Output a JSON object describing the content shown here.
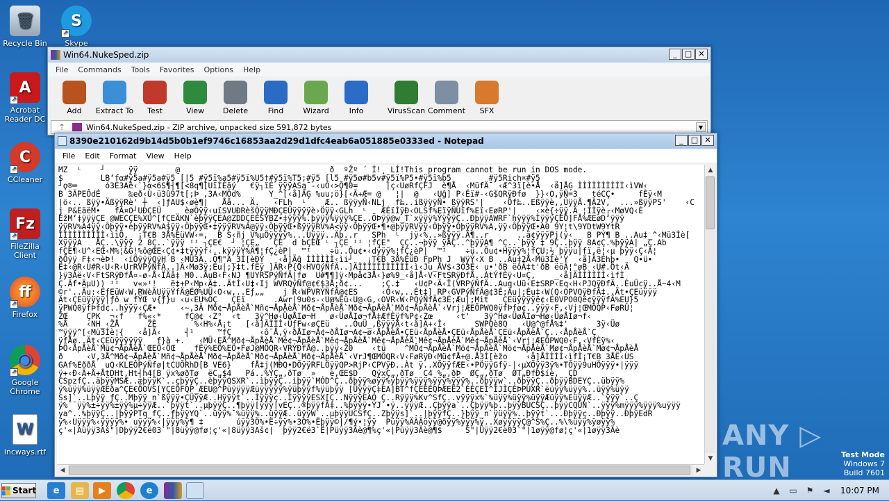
{
  "desktop": {
    "icons": [
      {
        "name": "recycle-bin",
        "label": "Recycle Bin",
        "glyph": "🗑"
      },
      {
        "name": "skype",
        "label": "Skype",
        "glyph": "S"
      },
      {
        "name": "acrobat-reader",
        "label": "Acrobat Reader DC",
        "glyph": "A"
      },
      {
        "name": "ccleaner",
        "label": "CCleaner",
        "glyph": "C"
      },
      {
        "name": "filezilla",
        "label": "FileZilla Client",
        "glyph": "Fz"
      },
      {
        "name": "firefox",
        "label": "Firefox",
        "glyph": "ff"
      },
      {
        "name": "chrome",
        "label": "Google Chrome",
        "glyph": "◉"
      },
      {
        "name": "incways-rtf",
        "label": "incways.rtf",
        "glyph": "W"
      }
    ]
  },
  "winrar": {
    "title": "Win64.NukeSped.zip",
    "menu": [
      "File",
      "Commands",
      "Tools",
      "Favorites",
      "Options",
      "Help"
    ],
    "toolbar": [
      {
        "label": "Add",
        "icon": "add-icon",
        "color": "#b8521e"
      },
      {
        "label": "Extract To",
        "icon": "folder-icon",
        "color": "#3b8fd6"
      },
      {
        "label": "Test",
        "icon": "test-icon",
        "color": "#c0392b"
      },
      {
        "label": "View",
        "icon": "book-icon",
        "color": "#2e8b3d"
      },
      {
        "label": "Delete",
        "icon": "trash-icon",
        "color": "#6f7a85"
      },
      {
        "label": "Find",
        "icon": "magnifier-icon",
        "color": "#2a6cc4"
      },
      {
        "label": "Wizard",
        "icon": "wand-icon",
        "color": "#6aa84f"
      },
      {
        "label": "Info",
        "icon": "info-icon",
        "color": "#2b6cc7"
      },
      {
        "label": "VirusScan",
        "icon": "bug-icon",
        "color": "#2e7d32"
      },
      {
        "label": "Comment",
        "icon": "comment-icon",
        "color": "#7d8fa3"
      },
      {
        "label": "SFX",
        "icon": "box-icon",
        "color": "#d8792b"
      }
    ],
    "path_text": "Win64.NukeSped.zip - ZIP archive, unpacked size 591,872 bytes"
  },
  "notepad": {
    "title": "8390e210162d9b14d5b0b1ef9746c16853aa2d29d1dfc4eab6a051885e0333ed - Notepad",
    "menu": [
      "File",
      "Edit",
      "Format",
      "View",
      "Help"
    ],
    "lines": [
      "MZ  ᴸ    ┘     ÿÿ        @                                ð  ºŽº ´ Í!¸ LÍ!This program cannot be run in DOS mode.",
      "$        LB‘fα#ÿ5a#ÿ5a#ÿ5 [|5 #ÿ5ï%a5#ÿ5ï%U5†#ÿ5ï%T5;#ÿ5 [l5 #ÿ5ø#b5v#ÿ5ï%P5•#ÿ5ï%b5        #ÿ5Rich¤#ÿ5",
      "┘ϙ®═      ó3È3Aê‹`}α<6S¶┤¶[<8q¶[UïÌÉäý   €ÿ┐ïÉ ÿÿÿASą¯-‹uÓ‹>Ǭ¶0=      |ç‹UøRfÇFJ  è¶Å  ‹MüfÄ¯_‹Æ^3ï[è•Å  ‹å]ÅĢ ÌÌÌÌÌÌÌÌÌÌ‹ìVW‹",
      "B 3ÃPEÔdÉ      ‰eð‹Ù‹ü3û97t[;Þ ,3A‹MÖd%      Y_^[‹å]ÃĢ %uu;ö}[‹Ã+Æ= @   ¦|  @   ‹Uĝ] P‹Éï#-‹G$QRÿÐfø  }}‹O,ÿÑ=3   téCÇ•     fÈÿ‹M",
      "|ö‹.. ßÿÿ•ÄßÿÿRè' ┼  ‹]ƒAU$‹øè¶|   Åå... Ä.   ‹FLh  ᴸ    Æ.. ßÿÿyÑ‹NLj  f‰..íßÿÿÿÑ• ßÿÿRS'|    ‹Öf‰..Eßÿÿè,,ÛÿÿÃ.¶Ä2V,  ...»ßÿÿPS'    ‹C",
      "j P&EäëM•   fÃ¤O┘UÐÇEÜ     èøÕÿÿ‹uïSVUÐRèšÕÿÿMÐÇEÜÿÿÿÿè›Öÿÿ‹GLh  ᴸ   ÆÉïÌÿÐ‹OLSf%EïÿÑUïf%Eï‹EøRP'|    ‹×è{÷ÿÿ.Ä ¦ÍÌÿè┌‹MøVQ‹È",
      "ÉžM‘‡ÿÿÿÇE @WECÇE%XU^[fÇEÄKN`èþÿÿÇEA@ZDDÇEÉSÝBZ•‡ÿÿÿ%.þÿÿÿ%ÿÿÿ%ÇE..ÕÞÿÿ@w_T`xÿÿÿ%ÝÿÿÿÇ..ÐþÿÿAWRF`hÿÿÿ%ÌÿÿÿÇEÖ]FÅ%ÆEøD‘ÿÿÿ",
      "ÿÿRV%A4ÿÿ‹Ôþÿÿ•èþÿÿRV%A$ÿÿ‹ÔþÿÿŒ•‡ÿÿÿRV%A@ÿÿ‹ÔþÿÿŒ•ßÿÿÿRV%A<ÿÿ‹ÔþÿÿŒ•¶•@þÿÿRVÿÿ‹Ôþÿÿ•ÒþÿÿRV%A,ÿÿ‹ÔþÿÿŒ•A0_9Y¦t\\9YDtW9YtR",
      "ÌÌÌÌÌÌÌÌÌÌ‹ìiÖ,  ¡T€B 3Å%EüVW‹=,  B S‹ñj V%µÖÿÿÿÿ%...Uÿÿÿ..Äþ..r   SPh  ᴸ  jÿ‹%..»ßÿÿÿ.Ä¶..r      ..ä¢ÿÿÿPj(ÿ‹   B PÝ¶ B ..Au‡_^‹Mü3Íè[",
      "XÿÿÿA   ÅÇ..\\ÿÿÿ 2 8Ç..`ÿÿÿ ᴵᴵ ┐ÇE€  ┘ ¦ÇE„   ÇE  d bÇEŒ ᴸ ┐ÇE ᴵᴵ ¦fÇE\"  ÇÇ..¬þÿÿ ÿÃÇ..^þÿÿA¶ ^Ç..`þÿÿ ‡ 9Ç..þÿÿ 8A¢Ç.%þÿÿA| „Ç.Ab",
      "fÇE¶‹U^‹EŒ‹M%¦&G!%ô@ŒE‹Ç¢•‡tÿÿÿf‹..kÿÿÿY%Ä¶¦fÇ¿èP|  ™ᴵ    ÷ü..Ôu¢•‹dÿÿÿ%¦fÇ¿èP|  ™ᴵ    ÷ü..Ôu¢•Hÿÿÿ%¦fÇU;½ þÿÿu|fï,ë¦‹µ þÿÿ‹Ç‹Ä¦",
      "ðÕÿÿ F‡‹¬èÞ!  ‹íÖÿÿÿQÿH B ‹MÜ3A..Õ¶\"A_3Í[èÐÝ   ‹å]Äĝ ÌÌÌÌÌÌ‹ìi┘   ¡T€B 3Å%EüÐ FpPh J  WÿÝ‹X B ..Au‡2Å‹Mü3Íè'Y  ‹å]Ä3Éhþ•   Q•ü•",
      "Ë‡‹@R‹U#R‹U‹R‹UrRVPýÑfÄ..]Ä‹Mø3ÿ;Éu|;}‡t.fÈÿ_]ÄR‹P{Q‹HVQýÑfÄ..]ÄÌÌÌÌÌÌÌÌÌÌÌ‹ì‹Ju_ÅV$‹3Ó3É‹ u•'ðB ëôÃ‡t'ðB ëöÃ¦°øB ‹U#.Öt‹Ä",
      "}ÿ3Áë‹V‹FtSRÿÐfÅ¤-ø-Å‹ÏÄå‡ M0..ÄuB‹F‹NJ ¶UYRSPýÑfÄ|fø  U#¶¶]ÿ‹Mpå¢3Å‹}ø%9_‹å]Å‹V‹FtSRÿÐfÅ..ÀtÝfÈÿ‹U¤Ç,    _‹å]ÄÌÌÌÌÌÌ‹ìfÌ",
      "Ç.Äf•ÄµU)) ᴵᴵ   v«»ᴵ!   ë‡+P‹Mp‹Ä‡..ÄtÌ‹U‡‹Ij WVRQýÑf@¢€$3Å;ð¢...    ;Ç.‡   ‹U¢P‹Ä‹Ï(VRPýÑfÄ..Auq‹Uü‹E‡SRP‹Eq‹H‹PJQÿÐfÄ..ÉuÜcÿ..Å~4‹M",
      "©r'..Äu:‹ÉƒEüW‹W,RWèÄUÿÿÝfÄ@ÉØ%UÜ‹O‹w,..Eƒ„„    j R‹WPVRÝÑfÄ@¢ES     ‹O‹w,..Ét‡] RP‹GVPýÑfÄ@¢3É;Äu|;Éu‡‹W(Q‹OPVQÿÐfÄ‡..Ät•ÇEüÿÿÿ",
      "Ät‹ÇEüÿÿÿÿ|ƒô w_fŸŒ v{ƒ}u ‹u‹EU%ÕÇ   ÇEï      .Awr|9u0s-‹U@%Eü‹U@‹G,‹OVR‹W‹PQýÑfÄ¢3É;Æu|;Mit   ÇEüÿÿÿÿë¢‹E0VPO0Që¢ÿÿÿfÄ%EU}5",
      "ÿPWQ0ÿfÞfd¢..hÿÿÿ‹ÇÆ•     ‹~,3Â Mð¢¬ÅpÅèÅ`Mñ¢¬ÅpÅèÅ`Mð¢¬ÅpÅèÅ`Mð¢¬ÅpÅèÅ`Mð¢¬ÅpÅèÅ`‹Vrj¦ÆEÕPWQ0ÿfÞfø¢..ÿÿÿ‹F‚‹Vj¦ŒMÖQP‹FøRÛ¦",
      "ŽŒ    ÇPK  ¬‹f   f%«‹*     fÇ@¢ ‹Z°  ‹t   3ÿ^Hø‹ÜøÅIø¬H   ø‹ÜøÅIø¬fÅ‡ÆfÈÿf%P¢‹Zœ     ‹t'   3ÿ^Hø‹ÜøÅIø¬Hø‹ÜøÅIø¬f‹",
      "%Å    ‹NH_‹ŽÅ      ŽÈ        %‹H%‹Å¡t   [‹å]ÃÌÌÌ‹ÜƒFw‹øÇEü   ..ÔuÜ_,ßÿÿÿÅ‹t‹å]Ä+‹Ì‹      SWPQè8Q   ‹U@^@fÅ%‡'      3ÿ‹Üø",
      "™ÿÿÿ^[‹Mü3Íè¦{   ‹å]Ä‹     ┤¹     ™fÇ      ‹ô¯Å,ÿ‹ðÅIø¬A¢~ðÅIø¬A¢~ø‹ÅpÅèÅ•ÇEü‹ÅpÅèÅ•ÇEü‹ÅpÅèÅ`ÇEü‹ÅpÅèÅ`Ç..‹ÅpÅèÅ`Ç",
      "ÿfÅø..Ät‹ÇEüÿÿÿÿÿÿ   f}à +.   ‹MÜ‹EÅ^Mð¢¬ÅpÅèÅ`Mé¢¬ÅpÅèÅ`Mê¢¬ÅpÅèÅ`Mê¢¬ÅpÅèÅ`Mê¢¬ÅpÅèÅ`Mê¢¬ÅpÅèÅ`‹Vrj¦ÆEÕPWQ0‹F‚‹VfÈÿ%‹",
      "ÞÖ‹ÅpÅèÅ`Mü¢¬ÅpÅèÅ`ŒEÖ‹ÖŒ    fÈÿ%EÖ%EÖ•FøJ@MÔQR‹VRÝÐfÅ@..þÿÿ‹Ž0    ‹tü    ^MÔ¢¬ÅpÅèÅ`Mö¢¬ÅpÅèÅ`Mö¢¬ÅpÅèÅ`Mø¢¬ÅpÅèÅ`Mø¢¬ÅpÅèÅ",
      "ð     ‹V,3Å^Mð¢¬ÅpÅèÅ`Mñ¢¬ÅpÅèÅ`Mð¢¬ÅpÅèÅ`Mð¢¬ÅpÅèÅ`Mð¢¬ÅpÅèÅ`‹VrJ¶ŒMÖQR‹V‹FøRÿÐ‹Mü¢fÅ+@.Å3Í[èžo    ‹å]ÅÌÌÌÌ‹ìfÌ¡T€B 3ÅË‹ÙS",
      "GAf%EððÅ  uQ‹KLEÔPýÑfø|tCUÕRhD[B VE6}    fÅ‡j(MÐQ•DÕÿÿRFLÖÿÿQP>RjP‹CPVÿÐ..Àt ÿ..XÕÿÿfÆE‹•PÖÿÿGfÿ-|‹µXÕÿÿ3ÿ%•TÕÿÿ9uHÖÿÿÿ•|ÿÿÿ",
      "ÿ+‹Ð‹Ä+Å+ÅtDHt‚Ht┤h4[B ÿx%øðTø  ëC„$4   Pá..%ÝÇ„,ðTø  »   ë,ŒE$D   QÿxÇ„,ðTø  C4 %„,ðÞ  ØÇ„,ðTø  ØT„ÐfÐ$íè,  ÇD",
      "CSpzfÇ..äþÿÿMSÆ..æþÿÿK`..çþÿÿÇ..èþÿÿQSXR`..ìþÿÿÇ..ìþÿÿ`MÓD^Ç..ðþÿÿ%øÿÿ%ÿþÿÿ%ÿÿÿ%ÿÿÿ%ÿÿÿ%..ðþÿÿw`..ðþÿÿÇ..ðþÿÿBDEYÇ..übÿÿ%",
      "ÿ%üÿÿ%üÿÿÆEða^ÇE€ÖOVS[YÇEÖFQP_ÆEU@^PüÿÿÿÿÆüÿÿÿÿÿ%ÿüþÿÿf%ÿüþÿÿ [ÜÿÿÿÇ‡EA]BT^fÇEÉÉQÞÆEË2`ÉÉÇEÍ^ÍJÌÇÉÞPUXR`ëüÿÿ%üÿÿ%..üÿÿ%üÿÿ",
      "Ss]`..Lþÿÿ ƒÇ..Mþÿÿ_n`ßÿÿÿ•ÇÜÿÿÆ..Hÿÿÿt`..Ìÿÿÿç..ÌÿÿÿÿESX[Ç..NÿÿÿEAO_Ç..Rÿÿÿ%Kv^SfÇ..vÿÿÿx%`%üÿÿ%üÿÿ%üÿÿÆüÿÿ%EüÿÿÆ..`ÿÿÿ`..Ç",
      "ÿ%¯¯ÿÿ%±÷ÿÿ%±ÿÿ%µ÷ÿÿÆ..`þÿÿt`..µþÿÿÇ..¶þÿÿ[ÿÿÿ|vEÇ..®þÿÿfÄ‡..%þÿÿÿ•ÝJ`•ÿ..ÿÿÿÆ..Çþÿÿa`..Çþÿÿ%þ..þÿÿBÚCSÇ..þÿÿCQÜN`..ÿÿÿ%mÿÿÿ%ÿÿÿ%uÿÿÿ",
      "ya^..%þÿÿÇ..|þÿÿPTq_fÇ..ƒþÿÿYQ`..üÿÿ%¯%üÿÿ%..üÿÿÆ..üÿÿW`..µþÿÿUCSfÇ..Zþÿÿs]`..|þÿÿfÇ..}þÿÿ_n`ÿüÿÿ%..þÿÿt`...Ðþÿÿç..Ðþÿÿ..ÐþÿEdR",
      "ÿ%‹Uÿÿÿ%‹ÿÿÿÿ%• uÿÿÿ%‹|ÿÿÿ%ÿ¶ ‡       úÿÿ3Ö%•Ë÷ÿÿ%•3Ò%•Ëþÿÿ©|/¶ý•¦ÿÿ  Püÿÿ%ÄÀÄöÿÿ@õÿÿ%ÿÿÿ%ÿ..XøÿÿÿÿÇ@^S%Ç..%\\%üÿÿ%ÿøÿÿ%",
      "ç'«|Aüÿÿ3Aš\"|Dþÿÿ2€ë03`\"|8üÿÿ@fø¦ç'«|8üÿÿ3Aš¢|  þÿÿ2€ë3`Ë|Püÿÿ3Äè@¶%ç'«|Püÿÿ3Äè@¶$     Š\"|Üÿÿ2€ë03`\"|1øÿÿ@fø¦ç'«|1øÿÿ3Äè"
    ]
  },
  "watermark": "ANY ▷ RUN",
  "test_mode": {
    "line1": "Test Mode",
    "line2": "Windows 7",
    "line3": "Build 7601"
  },
  "taskbar": {
    "start_label": "Start",
    "clock": "10:07 PM"
  }
}
